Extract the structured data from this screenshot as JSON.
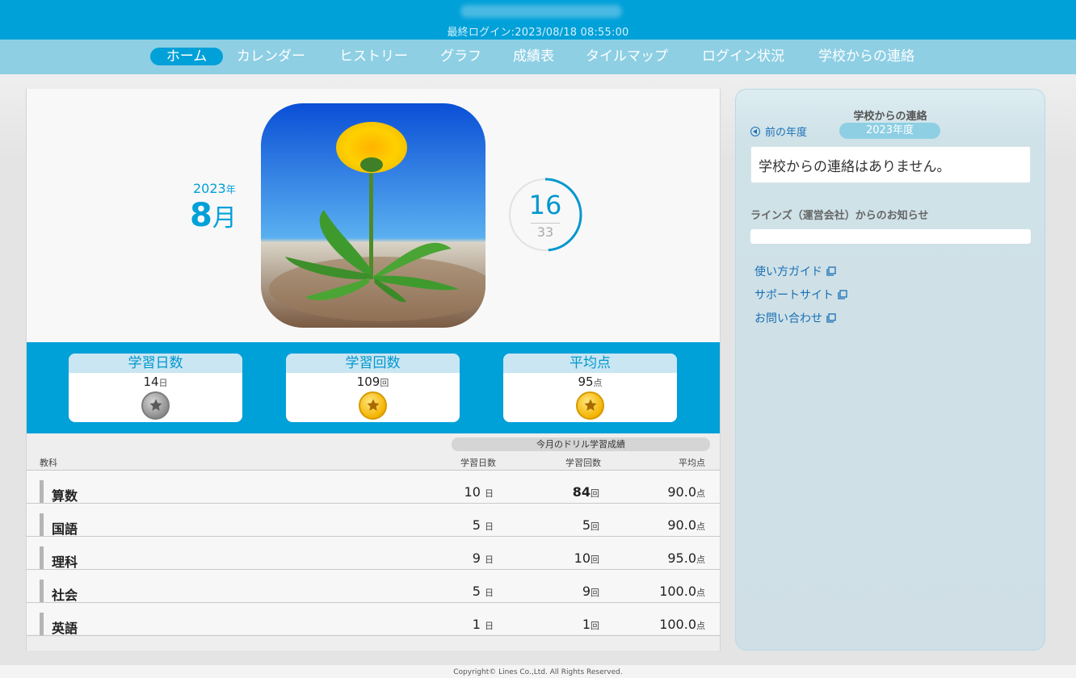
{
  "header": {
    "last_login": "最終ログイン:2023/08/18 08:55:00"
  },
  "nav": {
    "items": [
      {
        "label": "ホーム",
        "active": true
      },
      {
        "label": "カレンダー",
        "active": false
      },
      {
        "label": "ヒストリー",
        "active": false
      },
      {
        "label": "グラフ",
        "active": false
      },
      {
        "label": "成績表",
        "active": false
      },
      {
        "label": "タイルマップ",
        "active": false
      },
      {
        "label": "ログイン状況",
        "active": false
      },
      {
        "label": "学校からの連絡",
        "active": false
      }
    ]
  },
  "hero": {
    "year": "2023",
    "year_unit": "年",
    "month": "8",
    "month_unit": "月",
    "progress_current": "16",
    "progress_total": "33",
    "progress_fraction": 0.485
  },
  "stats": [
    {
      "title": "学習日数",
      "value": "14",
      "unit": "日",
      "medal": "silver"
    },
    {
      "title": "学習回数",
      "value": "109",
      "unit": "回",
      "medal": "gold"
    },
    {
      "title": "平均点",
      "value": "95",
      "unit": "点",
      "medal": "gold"
    }
  ],
  "table": {
    "group_header": "今月のドリル学習成績",
    "col_subject": "教科",
    "col_days": "学習日数",
    "col_count": "学習回数",
    "col_avg": "平均点",
    "rows": [
      {
        "subject": "算数",
        "days": "10",
        "days_unit": "日",
        "count": "84",
        "count_unit": "回",
        "avg": "90.0",
        "avg_unit": "点",
        "count_bold": true
      },
      {
        "subject": "国語",
        "days": "5",
        "days_unit": "日",
        "count": "5",
        "count_unit": "回",
        "avg": "90.0",
        "avg_unit": "点",
        "count_bold": false
      },
      {
        "subject": "理科",
        "days": "9",
        "days_unit": "日",
        "count": "10",
        "count_unit": "回",
        "avg": "95.0",
        "avg_unit": "点",
        "count_bold": false
      },
      {
        "subject": "社会",
        "days": "5",
        "days_unit": "日",
        "count": "9",
        "count_unit": "回",
        "avg": "100.0",
        "avg_unit": "点",
        "count_bold": false
      },
      {
        "subject": "英語",
        "days": "1",
        "days_unit": "日",
        "count": "1",
        "count_unit": "回",
        "avg": "100.0",
        "avg_unit": "点",
        "count_bold": false
      }
    ]
  },
  "right_panel": {
    "title": "学校からの連絡",
    "prev_year": "前の年度",
    "current_year": "2023年度",
    "school_notice": "学校からの連絡はありません。",
    "lines_title": "ラインズ（運営会社）からのお知らせ",
    "links": [
      "使い方ガイド",
      "サポートサイト",
      "お問い合わせ"
    ]
  },
  "footer": {
    "copyright": "Copyright© Lines Co.,Ltd. All Rights Reserved."
  },
  "colors": {
    "primary": "#00a0d8",
    "nav_bg": "#8ecfe4",
    "link": "#1a6fb5"
  }
}
